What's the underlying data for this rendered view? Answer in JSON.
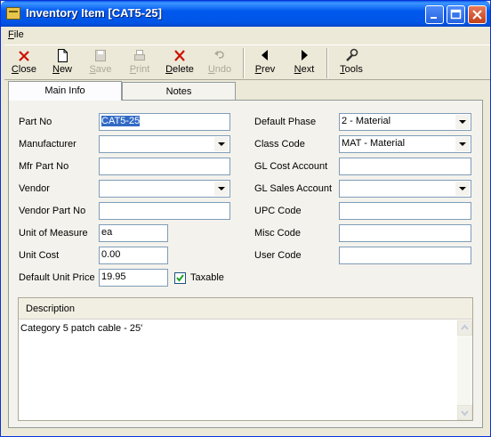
{
  "window": {
    "title": "Inventory Item [CAT5-25]"
  },
  "menu": {
    "file": "File",
    "file_mnemonic": "F",
    "file_rest": "ile"
  },
  "toolbar": {
    "close": "Close",
    "new": "New",
    "save": "Save",
    "print": "Print",
    "delete": "Delete",
    "undo": "Undo",
    "prev": "Prev",
    "next": "Next",
    "tools": "Tools"
  },
  "tabs": {
    "main": "Main Info",
    "notes": "Notes"
  },
  "fields": {
    "part_no": {
      "label": "Part No",
      "value": "CAT5-25"
    },
    "manufacturer": {
      "label": "Manufacturer",
      "value": ""
    },
    "mfr_part_no": {
      "label": "Mfr Part No",
      "value": ""
    },
    "vendor": {
      "label": "Vendor",
      "value": ""
    },
    "vendor_part_no": {
      "label": "Vendor Part No",
      "value": ""
    },
    "unit_of_measure": {
      "label": "Unit of Measure",
      "value": "ea"
    },
    "unit_cost": {
      "label": "Unit Cost",
      "value": "0.00"
    },
    "default_unit_price": {
      "label": "Default Unit Price",
      "value": "19.95"
    },
    "taxable": {
      "label": "Taxable",
      "checked": true
    },
    "default_phase": {
      "label": "Default Phase",
      "value": "2 - Material"
    },
    "class_code": {
      "label": "Class Code",
      "value": "MAT - Material"
    },
    "gl_cost_account": {
      "label": "GL Cost Account",
      "value": ""
    },
    "gl_sales_account": {
      "label": "GL Sales Account",
      "value": ""
    },
    "upc_code": {
      "label": "UPC Code",
      "value": ""
    },
    "misc_code": {
      "label": "Misc Code",
      "value": ""
    },
    "user_code": {
      "label": "User Code",
      "value": ""
    }
  },
  "description": {
    "label": "Description",
    "value": "Category 5 patch cable - 25'"
  },
  "colors": {
    "titlebar": "#0058EE",
    "panel": "#F3F2EC",
    "delete_icon": "#CC1100"
  }
}
